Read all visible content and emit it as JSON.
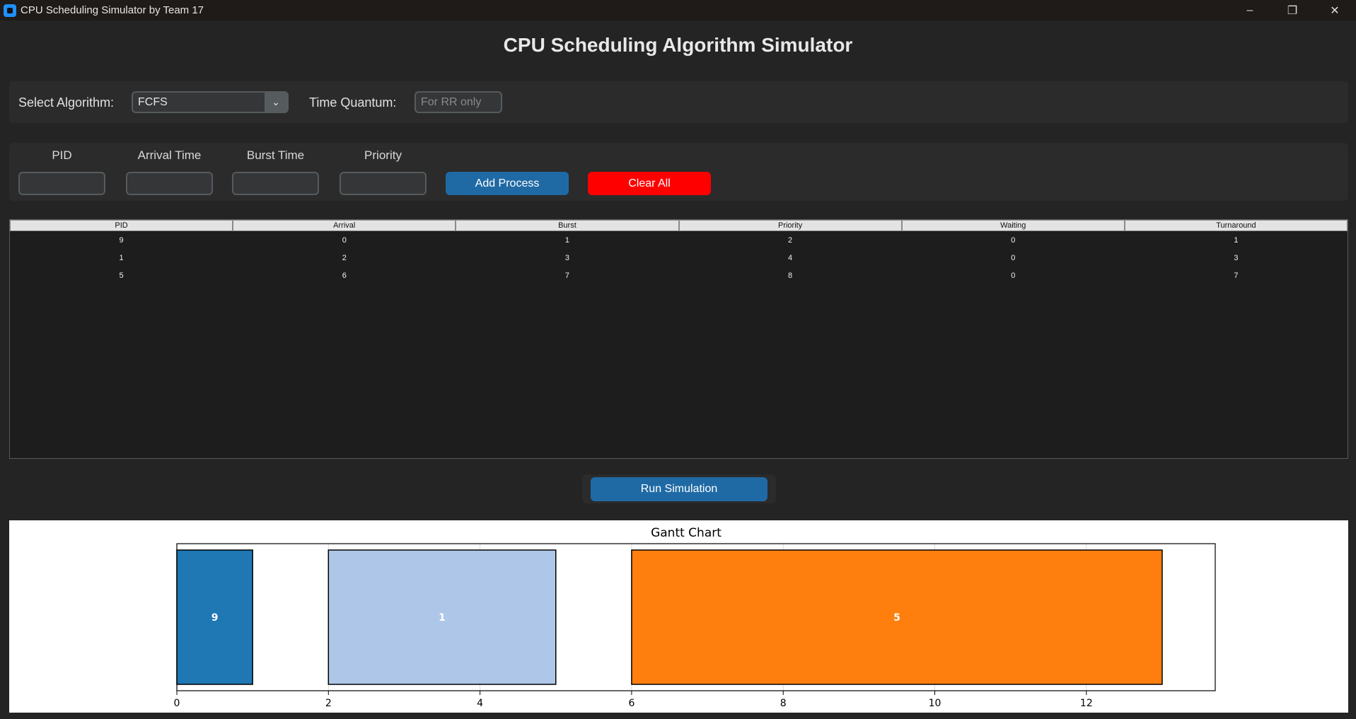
{
  "window": {
    "title": "CPU Scheduling Simulator by Team 17",
    "minimize": "–",
    "maximize": "❐",
    "close": "✕"
  },
  "header": {
    "title": "CPU Scheduling Algorithm Simulator"
  },
  "settings": {
    "algorithm_label": "Select Algorithm:",
    "algorithm_value": "FCFS",
    "quantum_label": "Time Quantum:",
    "quantum_placeholder": "For RR only"
  },
  "form": {
    "pid_label": "PID",
    "arrival_label": "Arrival Time",
    "burst_label": "Burst Time",
    "priority_label": "Priority",
    "add_button": "Add Process",
    "clear_button": "Clear All"
  },
  "table": {
    "headers": [
      "PID",
      "Arrival",
      "Burst",
      "Priority",
      "Waiting",
      "Turnaround"
    ],
    "rows": [
      [
        "9",
        "0",
        "1",
        "2",
        "0",
        "1"
      ],
      [
        "1",
        "2",
        "3",
        "4",
        "0",
        "3"
      ],
      [
        "5",
        "6",
        "7",
        "8",
        "0",
        "7"
      ]
    ]
  },
  "run_button": "Run Simulation",
  "chart_data": {
    "type": "gantt",
    "title": "Gantt Chart",
    "xlabel": "",
    "xlim": [
      0,
      13.7
    ],
    "xticks": [
      0,
      2,
      4,
      6,
      8,
      10,
      12
    ],
    "grid": "vertical",
    "bars": [
      {
        "label": "9",
        "start": 0,
        "end": 1,
        "color": "#1f77b4"
      },
      {
        "label": "1",
        "start": 2,
        "end": 5,
        "color": "#aec7e8"
      },
      {
        "label": "5",
        "start": 6,
        "end": 13,
        "color": "#ff7f0e"
      }
    ]
  },
  "colors": {
    "add_button": "#1f6aa5",
    "clear_button": "#ff0000",
    "run_button": "#1f6aa5"
  }
}
